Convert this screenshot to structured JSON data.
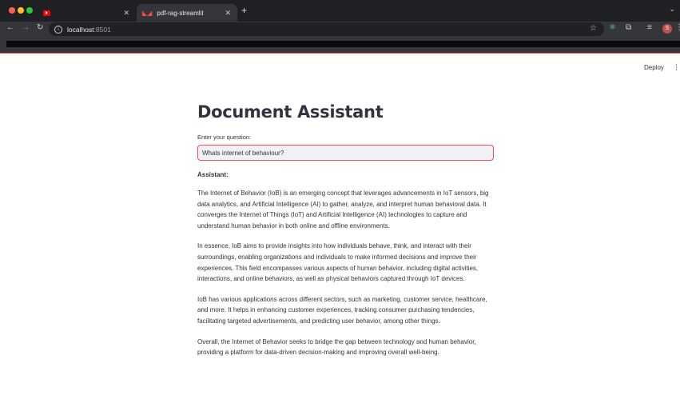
{
  "browser": {
    "tabs": [
      {
        "title": "",
        "favicon": "youtube-icon",
        "active": false
      },
      {
        "title": "pdf-rag-streamlit",
        "favicon": "streamlit-icon",
        "active": true
      }
    ],
    "new_tab_label": "+",
    "url_host": "localhost",
    "url_port": ":8501",
    "profile_initial": "S",
    "accent_color": "#ff4b4b"
  },
  "app": {
    "deploy_label": "Deploy",
    "title": "Document Assistant",
    "question_label": "Enter your question:",
    "question_value": "Whats internet of behaviour?",
    "assistant_label": "Assistant:",
    "paragraphs": [
      "The Internet of Behavior (IoB) is an emerging concept that leverages advancements in IoT sensors, big data analytics, and Artificial Intelligence (AI) to gather, analyze, and interpret human behavioral data. It converges the Internet of Things (IoT) and Artificial Intelligence (AI) technologies to capture and understand human behavior in both online and offline environments.",
      "In essence, IoB aims to provide insights into how individuals behave, think, and interact with their surroundings, enabling organizations and individuals to make informed decisions and improve their experiences. This field encompasses various aspects of human behavior, including digital activities, interactions, and online behaviors, as well as physical behaviors captured through IoT devices.",
      "IoB has various applications across different sectors, such as marketing, customer service, healthcare, and more. It helps in enhancing customer experiences, tracking consumer purchasing tendencies, facilitating targeted advertisements, and predicting user behavior, among other things.",
      "Overall, the Internet of Behavior seeks to bridge the gap between technology and human behavior, providing a platform for data-driven decision-making and improving overall well-being."
    ]
  }
}
